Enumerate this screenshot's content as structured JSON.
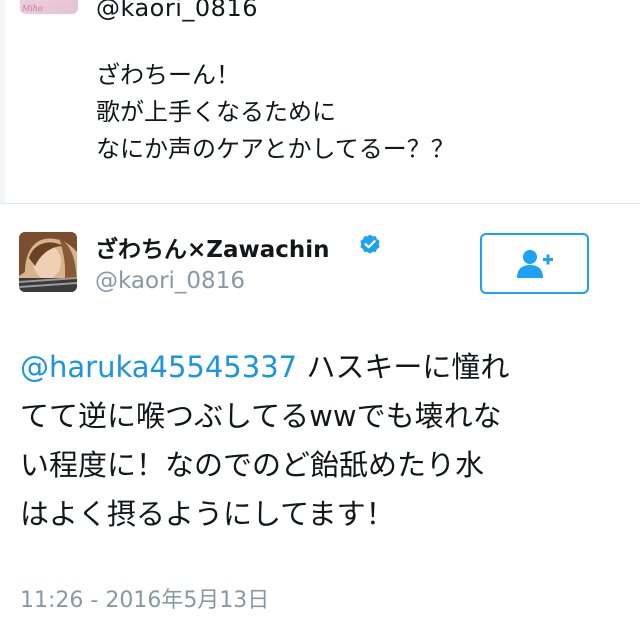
{
  "previous_tweet": {
    "avatar_label": "Miho",
    "handle": "@kaori_0816",
    "text_lines": [
      "ざわちーん！",
      "歌が上手くなるために",
      "なにか声のケアとかしてるー？？"
    ]
  },
  "tweet": {
    "display_name": "ざわちん×Zawachin",
    "handle": "@kaori_0816",
    "verified_icon": "verified-badge-icon",
    "follow_icon": "add-user-icon",
    "mention": "@haruka45545337",
    "text_lines": [
      " ハスキーに憧れ",
      "てて逆に喉つぶしてるwwでも壊れな",
      "い程度に！なのでのど飴舐めたり水",
      "はよく摂るようにしてます！"
    ],
    "timestamp": "11:26 - 2016年5月13日"
  },
  "colors": {
    "accent": "#1da1f2",
    "mention": "#1b95e0",
    "text": "#14171a",
    "muted": "#8899a6",
    "divider": "#e1e8ed"
  }
}
